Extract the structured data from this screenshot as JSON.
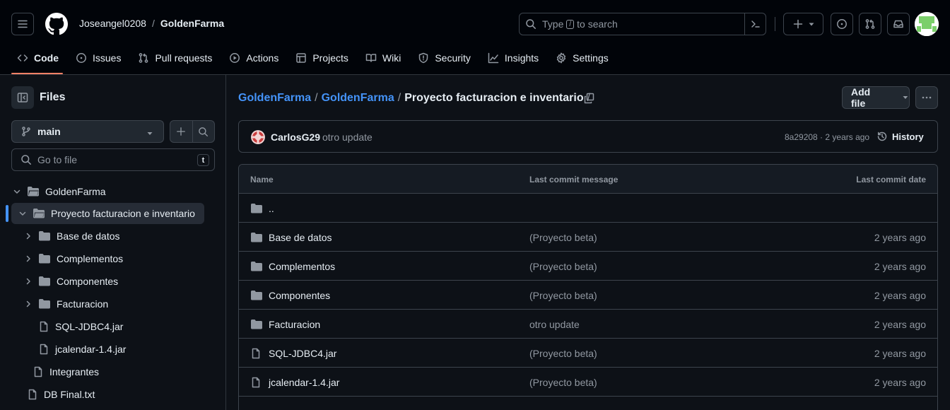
{
  "header": {
    "owner": "Joseangel0208",
    "separator": "/",
    "repo": "GoldenFarma",
    "search_prefix": "Type",
    "search_key": "/",
    "search_suffix": "to search"
  },
  "tabs": [
    {
      "label": "Code",
      "icon": "code-icon",
      "active": true
    },
    {
      "label": "Issues",
      "icon": "issue-icon"
    },
    {
      "label": "Pull requests",
      "icon": "pull-request-icon"
    },
    {
      "label": "Actions",
      "icon": "play-icon"
    },
    {
      "label": "Projects",
      "icon": "table-icon"
    },
    {
      "label": "Wiki",
      "icon": "book-icon"
    },
    {
      "label": "Security",
      "icon": "shield-icon"
    },
    {
      "label": "Insights",
      "icon": "graph-icon"
    },
    {
      "label": "Settings",
      "icon": "gear-icon"
    }
  ],
  "sidebar": {
    "title": "Files",
    "branch": "main",
    "goto_placeholder": "Go to file",
    "goto_key": "t",
    "tree": [
      {
        "label": "GoldenFarma",
        "type": "folder-open",
        "expanded": true
      },
      {
        "label": "Proyecto facturacion e inventario",
        "type": "folder-open",
        "expanded": true,
        "selected": true
      },
      {
        "label": "Base de datos",
        "type": "folder"
      },
      {
        "label": "Complementos",
        "type": "folder"
      },
      {
        "label": "Componentes",
        "type": "folder"
      },
      {
        "label": "Facturacion",
        "type": "folder"
      },
      {
        "label": "SQL-JDBC4.jar",
        "type": "file"
      },
      {
        "label": "jcalendar-1.4.jar",
        "type": "file"
      },
      {
        "label": "Integrantes",
        "type": "file"
      },
      {
        "label": "DB Final.txt",
        "type": "file"
      }
    ]
  },
  "path": {
    "root": "GoldenFarma",
    "sep": "/",
    "repo_dir": "GoldenFarma",
    "current": "Proyecto facturacion e inventario",
    "trailing": "/"
  },
  "toolbar": {
    "add_file": "Add file"
  },
  "commit": {
    "author": "CarlosG29",
    "message": "otro update",
    "meta": "8a29208 · 2 years ago",
    "history": "History"
  },
  "table": {
    "headers": {
      "name": "Name",
      "message": "Last commit message",
      "date": "Last commit date"
    },
    "parent": "..",
    "rows": [
      {
        "name": "Base de datos",
        "type": "folder",
        "message": "(Proyecto beta)",
        "date": "2 years ago"
      },
      {
        "name": "Complementos",
        "type": "folder",
        "message": "(Proyecto beta)",
        "date": "2 years ago"
      },
      {
        "name": "Componentes",
        "type": "folder",
        "message": "(Proyecto beta)",
        "date": "2 years ago"
      },
      {
        "name": "Facturacion",
        "type": "folder",
        "message": "otro update",
        "date": "2 years ago"
      },
      {
        "name": "SQL-JDBC4.jar",
        "type": "file",
        "message": "(Proyecto beta)",
        "date": "2 years ago"
      },
      {
        "name": "jcalendar-1.4.jar",
        "type": "file",
        "message": "(Proyecto beta)",
        "date": "2 years ago"
      }
    ]
  },
  "colors": {
    "accent_link": "#4493f8",
    "tab_underline": "#f78166",
    "background": "#0d1117"
  }
}
